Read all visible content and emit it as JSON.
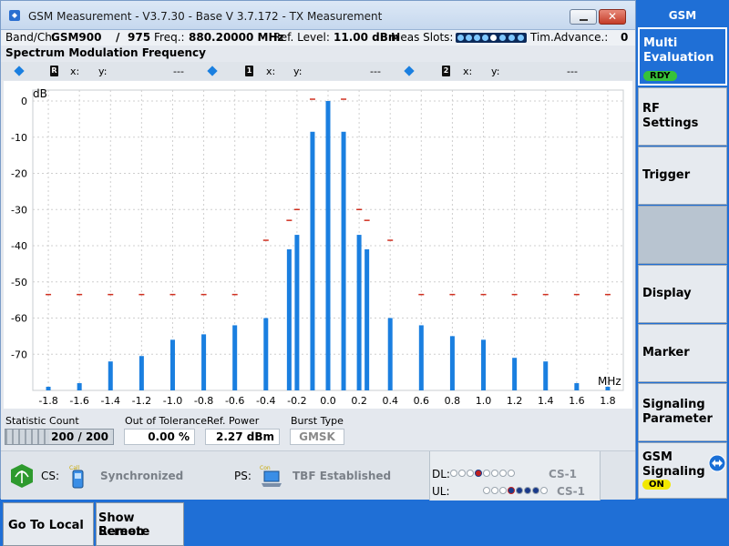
{
  "window": {
    "title": "GSM Measurement  - V3.7.30 - Base V 3.7.172 - TX Measurement"
  },
  "info": {
    "band_label": "Band/Ch:",
    "band_value": "GSM900",
    "separator": "/",
    "channel": "975",
    "freq_label": "Freq.:",
    "freq_value": "880.20000 MHz",
    "ref_label": "Ref. Level:",
    "ref_value": "11.00 dBm",
    "slots_label": "Meas Slots:",
    "tim_adv_label": "Tim.Advance.:",
    "tim_adv_value": "0"
  },
  "spectrum_title": "Spectrum Modulation Frequency",
  "markers": [
    {
      "id": "R",
      "x_label": "x:",
      "y_label": "y:",
      "value": "---"
    },
    {
      "id": "1",
      "x_label": "x:",
      "y_label": "y:",
      "value": "---"
    },
    {
      "id": "2",
      "x_label": "x:",
      "y_label": "y:",
      "value": "---"
    }
  ],
  "chart_data": {
    "type": "bar",
    "ylabel": "dB",
    "xlabel": "MHz",
    "ylim": [
      -80,
      0
    ],
    "xlim": [
      -1.9,
      1.9
    ],
    "y_ticks": [
      0,
      -10,
      -20,
      -30,
      -40,
      -50,
      -60,
      -70
    ],
    "x_ticks": [
      -1.8,
      -1.6,
      -1.4,
      -1.2,
      -1.0,
      -0.8,
      -0.6,
      -0.4,
      -0.2,
      0.0,
      0.2,
      0.4,
      0.6,
      0.8,
      1.0,
      1.2,
      1.4,
      1.6,
      1.8
    ],
    "x_tick_labels": [
      "-1.8",
      "-1.6",
      "-1.4",
      "-1.2",
      "-1.0",
      "-0.8",
      "-0.6",
      "-0.4",
      "-0.2",
      "0.0",
      "0.2",
      "0.4",
      "0.6",
      "0.8",
      "1.0",
      "1.2",
      "1.4",
      "1.6",
      "1.8"
    ],
    "grid": true,
    "bar_color": "#1a7fe0",
    "limit_color": "#d03020",
    "bars": [
      {
        "x": -1.8,
        "y": -79
      },
      {
        "x": -1.6,
        "y": -78
      },
      {
        "x": -1.4,
        "y": -72
      },
      {
        "x": -1.2,
        "y": -70.5
      },
      {
        "x": -1.0,
        "y": -66
      },
      {
        "x": -0.8,
        "y": -64.5
      },
      {
        "x": -0.6,
        "y": -62
      },
      {
        "x": -0.4,
        "y": -60
      },
      {
        "x": -0.25,
        "y": -41
      },
      {
        "x": -0.2,
        "y": -37
      },
      {
        "x": -0.1,
        "y": -8.5
      },
      {
        "x": 0.0,
        "y": 0
      },
      {
        "x": 0.1,
        "y": -8.5
      },
      {
        "x": 0.2,
        "y": -37
      },
      {
        "x": 0.25,
        "y": -41
      },
      {
        "x": 0.4,
        "y": -60
      },
      {
        "x": 0.6,
        "y": -62
      },
      {
        "x": 0.8,
        "y": -65
      },
      {
        "x": 1.0,
        "y": -66
      },
      {
        "x": 1.2,
        "y": -71
      },
      {
        "x": 1.4,
        "y": -72
      },
      {
        "x": 1.6,
        "y": -78
      },
      {
        "x": 1.8,
        "y": -79
      }
    ],
    "limits": [
      {
        "x": -1.8,
        "y": -53.5
      },
      {
        "x": -1.6,
        "y": -53.5
      },
      {
        "x": -1.4,
        "y": -53.5
      },
      {
        "x": -1.2,
        "y": -53.5
      },
      {
        "x": -1.0,
        "y": -53.5
      },
      {
        "x": -0.8,
        "y": -53.5
      },
      {
        "x": -0.6,
        "y": -53.5
      },
      {
        "x": -0.4,
        "y": -38.5
      },
      {
        "x": -0.25,
        "y": -33
      },
      {
        "x": -0.2,
        "y": -30
      },
      {
        "x": -0.1,
        "y": 0.5
      },
      {
        "x": 0.1,
        "y": 0.5
      },
      {
        "x": 0.2,
        "y": -30
      },
      {
        "x": 0.25,
        "y": -33
      },
      {
        "x": 0.4,
        "y": -38.5
      },
      {
        "x": 0.6,
        "y": -53.5
      },
      {
        "x": 0.8,
        "y": -53.5
      },
      {
        "x": 1.0,
        "y": -53.5
      },
      {
        "x": 1.2,
        "y": -53.5
      },
      {
        "x": 1.4,
        "y": -53.5
      },
      {
        "x": 1.6,
        "y": -53.5
      },
      {
        "x": 1.8,
        "y": -53.5
      }
    ]
  },
  "stats": {
    "statistic_count_label": "Statistic Count",
    "statistic_count_value": "200 / 200",
    "statistic_progress": 1.0,
    "out_of_tolerance_label": "Out of Tolerance",
    "out_of_tolerance_value": "0.00  %",
    "ref_power_label": "Ref. Power",
    "ref_power_value": "2.27  dBm",
    "burst_type_label": "Burst Type",
    "burst_type_value": "GMSK"
  },
  "status": {
    "cs_label": "CS:",
    "cs_value": "Synchronized",
    "ps_label": "PS:",
    "ps_value": "TBF Established",
    "dl_label": "DL:",
    "dl_value": "CS-1",
    "ul_label": "UL:",
    "ul_value": "CS-1"
  },
  "side": {
    "title": "GSM",
    "softkeys": [
      {
        "label_1": "Multi",
        "label_2": "Evaluation",
        "badge": "RDY"
      },
      {
        "label_1": "RF",
        "label_2": "Settings"
      },
      {
        "label_1": "Trigger"
      },
      {
        "label_1": ""
      },
      {
        "label_1": "Display"
      },
      {
        "label_1": "Marker"
      },
      {
        "label_1": "Signaling",
        "label_2": "Parameter"
      },
      {
        "label_1": "GSM",
        "label_2": "Signaling",
        "badge": "ON"
      }
    ]
  },
  "bottom": {
    "go_to_local": "Go To Local",
    "show_remote_1": "Show Remote",
    "show_remote_2": "Screen"
  },
  "colors": {
    "accent": "#1f6fd6",
    "bar": "#1a7fe0",
    "limit": "#d03020",
    "ready": "#36c23a",
    "on": "#f2e800"
  }
}
